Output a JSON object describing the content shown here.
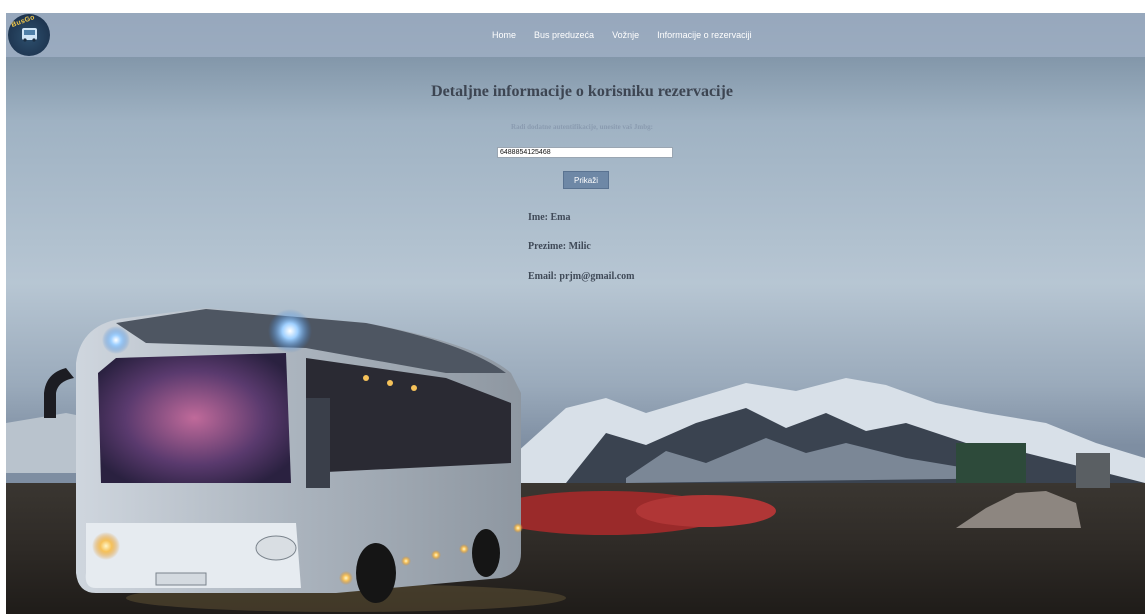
{
  "nav": {
    "logo_text": "BusGo",
    "links": [
      {
        "label": "Home"
      },
      {
        "label": "Bus preduzeća"
      },
      {
        "label": "Vožnje"
      },
      {
        "label": "Informacije o rezervaciji"
      }
    ]
  },
  "main": {
    "title": "Detaljne informacije o korisniku rezervacije",
    "subtitle": "Radi dodatne autentifikacije, unesite vaš Jmbg:",
    "jmbg_value": "6488854125468",
    "show_button_label": "Prikaži",
    "first_name": "Ime: Ema",
    "last_name": "Prezime: Milic",
    "email": "Email: prjm@gmail.com"
  },
  "colors": {
    "navbar": "#a0b0c4",
    "button": "#6e88a6",
    "title_text": "#3d4552"
  }
}
